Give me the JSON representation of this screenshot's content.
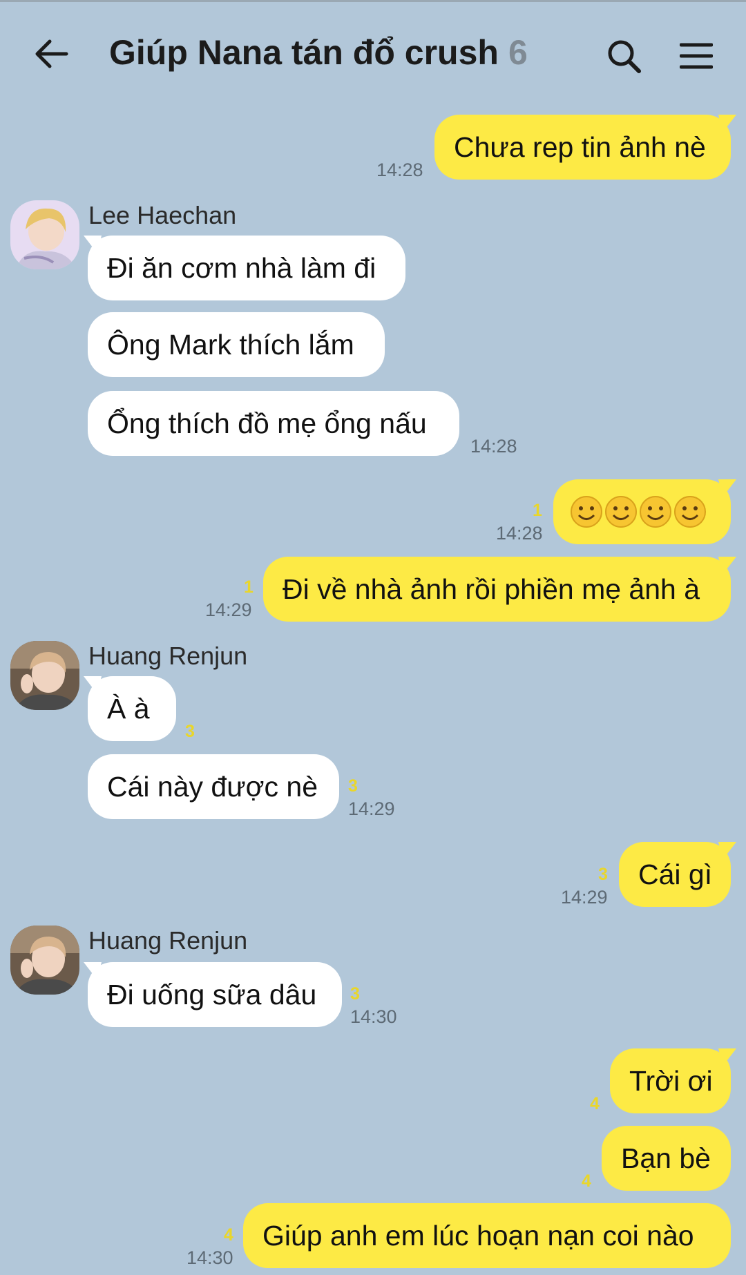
{
  "header": {
    "title": "Giúp Nana tán đổ crush",
    "member_count": "6"
  },
  "colors": {
    "background": "#b2c7d9",
    "my_bubble": "#fdea45",
    "other_bubble": "#ffffff",
    "unread": "#e9d62a"
  },
  "messages": {
    "m1": {
      "text": "Chưa rep tin ảnh nè",
      "time": "14:28"
    },
    "haechan": {
      "name": "Lee Haechan"
    },
    "m2": {
      "text": "Đi ăn cơm nhà làm đi"
    },
    "m3": {
      "text": "Ông Mark thích lắm"
    },
    "m4": {
      "text": "Ổng thích đồ mẹ ổng nấu",
      "time": "14:28"
    },
    "m5": {
      "emoji": "😊😊😊😊",
      "unread": "1",
      "time": "14:28"
    },
    "m6": {
      "text": "Đi về nhà ảnh rồi phiền mẹ ảnh à",
      "unread": "1",
      "time": "14:29"
    },
    "renjun1": {
      "name": "Huang Renjun"
    },
    "m7": {
      "text": "À à",
      "unread": "3"
    },
    "m8": {
      "text": "Cái này được nè",
      "unread": "3",
      "time": "14:29"
    },
    "m9": {
      "text": "Cái gì",
      "unread": "3",
      "time": "14:29"
    },
    "renjun2": {
      "name": "Huang Renjun"
    },
    "m10": {
      "text": "Đi uống sữa dâu",
      "unread": "3",
      "time": "14:30"
    },
    "m11": {
      "text": "Trời ơi",
      "unread": "4"
    },
    "m12": {
      "text": "Bạn bè",
      "unread": "4"
    },
    "m13": {
      "text": "Giúp anh em lúc hoạn nạn coi nào",
      "unread": "4",
      "time": "14:30"
    }
  }
}
